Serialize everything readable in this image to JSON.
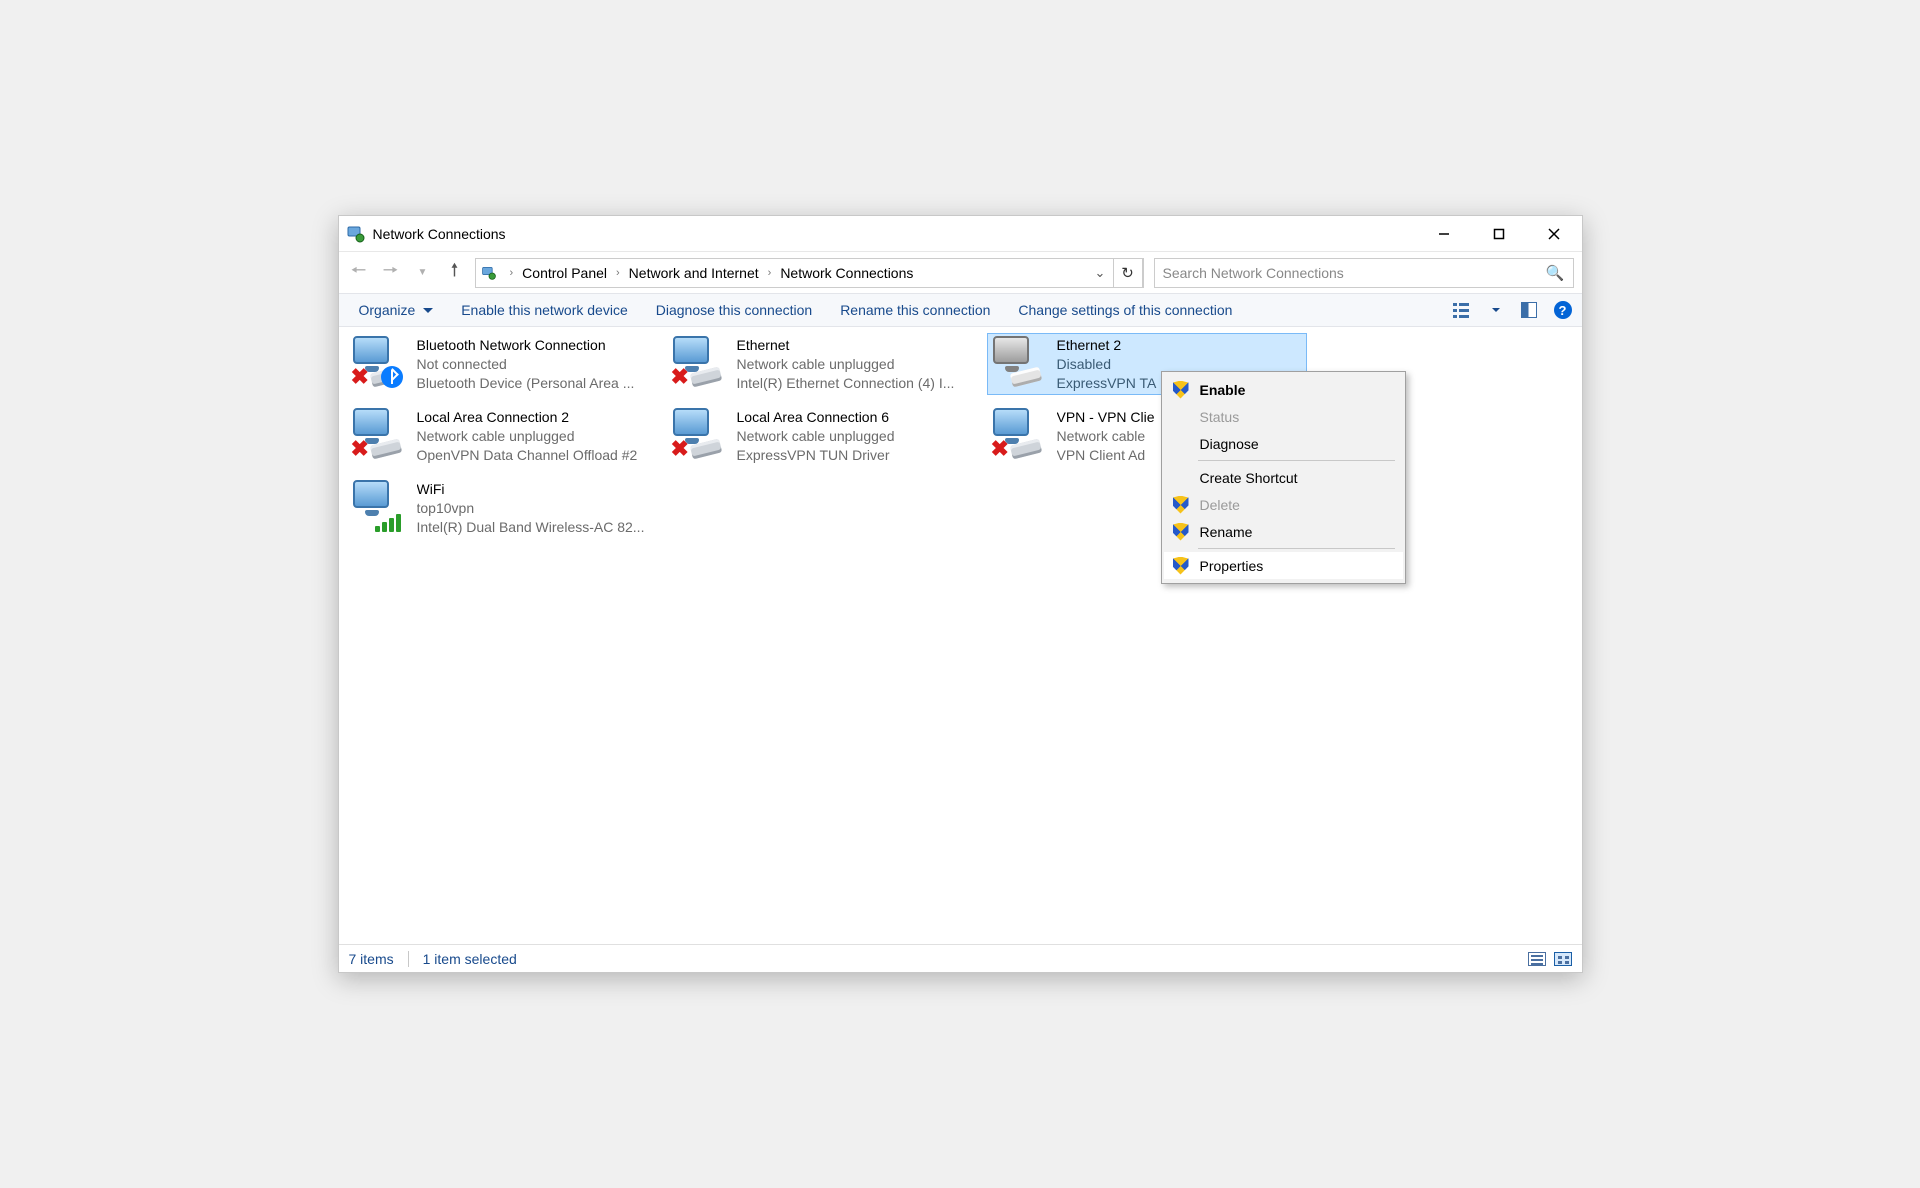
{
  "window": {
    "title": "Network Connections"
  },
  "breadcrumb": {
    "items": [
      "Control Panel",
      "Network and Internet",
      "Network Connections"
    ]
  },
  "search": {
    "placeholder": "Search Network Connections"
  },
  "commandbar": {
    "organize": "Organize",
    "enable": "Enable this network device",
    "diagnose": "Diagnose this connection",
    "rename": "Rename this connection",
    "change": "Change settings of this connection"
  },
  "adapters": [
    {
      "name": "Bluetooth Network Connection",
      "status": "Not connected",
      "device": "Bluetooth Device (Personal Area ...",
      "badge": "bt",
      "warn": true,
      "disabled": false,
      "selected": false
    },
    {
      "name": "Ethernet",
      "status": "Network cable unplugged",
      "device": "Intel(R) Ethernet Connection (4) I...",
      "badge": null,
      "warn": true,
      "disabled": false,
      "selected": false
    },
    {
      "name": "Ethernet 2",
      "status": "Disabled",
      "device": "ExpressVPN TA",
      "badge": null,
      "warn": false,
      "disabled": true,
      "selected": true
    },
    {
      "name": "Local Area Connection 2",
      "status": "Network cable unplugged",
      "device": "OpenVPN Data Channel Offload #2",
      "badge": null,
      "warn": true,
      "disabled": false,
      "selected": false
    },
    {
      "name": "Local Area Connection 6",
      "status": "Network cable unplugged",
      "device": "ExpressVPN TUN Driver",
      "badge": null,
      "warn": true,
      "disabled": false,
      "selected": false
    },
    {
      "name": "VPN - VPN Clie",
      "status": "Network cable",
      "device": "VPN Client Ad",
      "badge": null,
      "warn": true,
      "disabled": false,
      "selected": false
    },
    {
      "name": "WiFi",
      "status": "top10vpn",
      "device": "Intel(R) Dual Band Wireless-AC 82...",
      "badge": "wifi",
      "warn": false,
      "disabled": false,
      "selected": false
    }
  ],
  "context_menu": {
    "items": [
      {
        "label": "Enable",
        "shield": true,
        "disabled": false,
        "bold": true,
        "sep_after": false,
        "highlight": false
      },
      {
        "label": "Status",
        "shield": false,
        "disabled": true,
        "bold": false,
        "sep_after": false,
        "highlight": false
      },
      {
        "label": "Diagnose",
        "shield": false,
        "disabled": false,
        "bold": false,
        "sep_after": true,
        "highlight": false
      },
      {
        "label": "Create Shortcut",
        "shield": false,
        "disabled": false,
        "bold": false,
        "sep_after": false,
        "highlight": false
      },
      {
        "label": "Delete",
        "shield": true,
        "disabled": true,
        "bold": false,
        "sep_after": false,
        "highlight": false
      },
      {
        "label": "Rename",
        "shield": true,
        "disabled": false,
        "bold": false,
        "sep_after": true,
        "highlight": false
      },
      {
        "label": "Properties",
        "shield": true,
        "disabled": false,
        "bold": false,
        "sep_after": false,
        "highlight": true
      }
    ]
  },
  "statusbar": {
    "count": "7 items",
    "selected": "1 item selected"
  }
}
